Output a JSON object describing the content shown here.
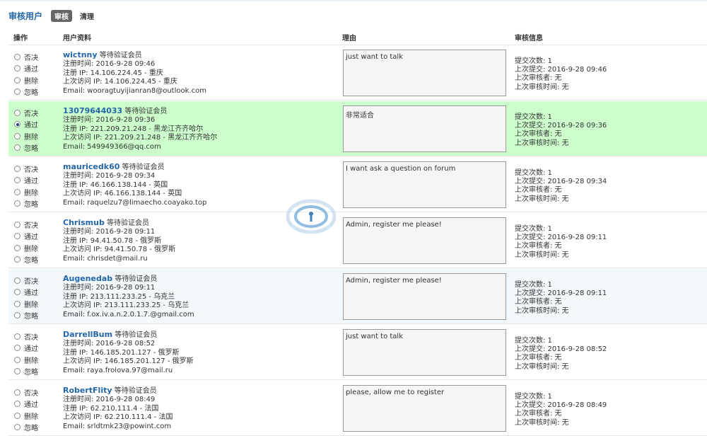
{
  "header": {
    "title": "审核用户",
    "tabs": [
      "审核",
      "清理"
    ]
  },
  "columns": {
    "op": "操作",
    "user": "用户资料",
    "reason": "理由",
    "info": "审核信息"
  },
  "ops_labels": [
    "否决",
    "通过",
    "删除",
    "忽略"
  ],
  "rows": [
    {
      "username": "wictnny",
      "status": "等待验证会员",
      "reg_time": "注册时间: 2016-9-28 09:46",
      "reg_ip": "注册 IP: 14.106.224.45 - 重庆",
      "last_ip": "上次访问 IP: 14.106.224.45 - 重庆",
      "email": "Email: wooragtuyijianran8@outlook.com",
      "reason": "just want to talk",
      "submit_count": "提交次数: 1",
      "last_submit": "上次提交: 2016-9-28 09:46",
      "last_reviewer": "上次审核者: 无",
      "last_review_time": "上次审核时间: 无",
      "selected": -1
    },
    {
      "username": "13079644033",
      "status": "等待验证会员",
      "reg_time": "注册时间: 2016-9-28 09:36",
      "reg_ip": "注册 IP: 221.209.21.248 - 黑龙江齐齐哈尔",
      "last_ip": "上次访问 IP: 221.209.21.248 - 黑龙江齐齐哈尔",
      "email": "Email: 549949366@qq.com",
      "reason": "非常适合",
      "submit_count": "提交次数: 1",
      "last_submit": "上次提交: 2016-9-28 09:36",
      "last_reviewer": "上次审核者: 无",
      "last_review_time": "上次审核时间: 无",
      "selected": 1
    },
    {
      "username": "mauricedk60",
      "status": "等待验证会员",
      "reg_time": "注册时间: 2016-9-28 09:34",
      "reg_ip": "注册 IP: 46.166.138.144 - 英国",
      "last_ip": "上次访问 IP: 46.166.138.144 - 英国",
      "email": "Email: raquelzu7@limaecho.coayako.top",
      "reason": "I want ask a question on forum",
      "submit_count": "提交次数: 1",
      "last_submit": "上次提交: 2016-9-28 09:34",
      "last_reviewer": "上次审核者: 无",
      "last_review_time": "上次审核时间: 无",
      "selected": -1
    },
    {
      "username": "Chrismub",
      "status": "等待验证会员",
      "reg_time": "注册时间: 2016-9-28 09:11",
      "reg_ip": "注册 IP: 94.41.50.78 - 俄罗斯",
      "last_ip": "上次访问 IP: 94.41.50.78 - 俄罗斯",
      "email": "Email: chrisdet@mail.ru",
      "reason": "Admin, register me please!",
      "submit_count": "提交次数: 1",
      "last_submit": "上次提交: 2016-9-28 09:11",
      "last_reviewer": "上次审核者: 无",
      "last_review_time": "上次审核时间: 无",
      "selected": -1
    },
    {
      "username": "Augenedab",
      "status": "等待验证会员",
      "reg_time": "注册时间: 2016-9-28 09:11",
      "reg_ip": "注册 IP: 213.111.233.25 - 乌克兰",
      "last_ip": "上次访问 IP: 213.111.233.25 - 乌克兰",
      "email": "Email: f.ox.iv.a.n.2.0.1.7.@gmail.com",
      "reason": "Admin, register me please!",
      "submit_count": "提交次数: 1",
      "last_submit": "上次提交: 2016-9-28 09:11",
      "last_reviewer": "上次审核者: 无",
      "last_review_time": "上次审核时间: 无",
      "selected": -1
    },
    {
      "username": "DarrellBum",
      "status": "等待验证会员",
      "reg_time": "注册时间: 2016-9-28 08:52",
      "reg_ip": "注册 IP: 146.185.201.127 - 俄罗斯",
      "last_ip": "上次访问 IP: 146.185.201.127 - 俄罗斯",
      "email": "Email: raya.frolova.97@mail.ru",
      "reason": "just want to talk",
      "submit_count": "提交次数: 1",
      "last_submit": "上次提交: 2016-9-28 08:52",
      "last_reviewer": "上次审核者: 无",
      "last_review_time": "上次审核时间: 无",
      "selected": -1
    },
    {
      "username": "RobertFlity",
      "status": "等待验证会员",
      "reg_time": "注册时间: 2016-9-28 08:49",
      "reg_ip": "注册 IP: 62.210.111.4 - 法国",
      "last_ip": "上次访问 IP: 62.210.111.4 - 法国",
      "email": "Email: srldtmk23@powint.com",
      "reason": "please, allow me to register",
      "submit_count": "提交次数: 1",
      "last_submit": "上次提交: 2016-9-28 08:49",
      "last_reviewer": "上次审核者: 无",
      "last_review_time": "上次审核时间: 无",
      "selected": -1
    }
  ],
  "colors": {
    "title": "#2366a8",
    "username": "#2366a8",
    "selected_row_bg": "#ccffcc",
    "alt_row_bg": "#f2f8fc"
  }
}
